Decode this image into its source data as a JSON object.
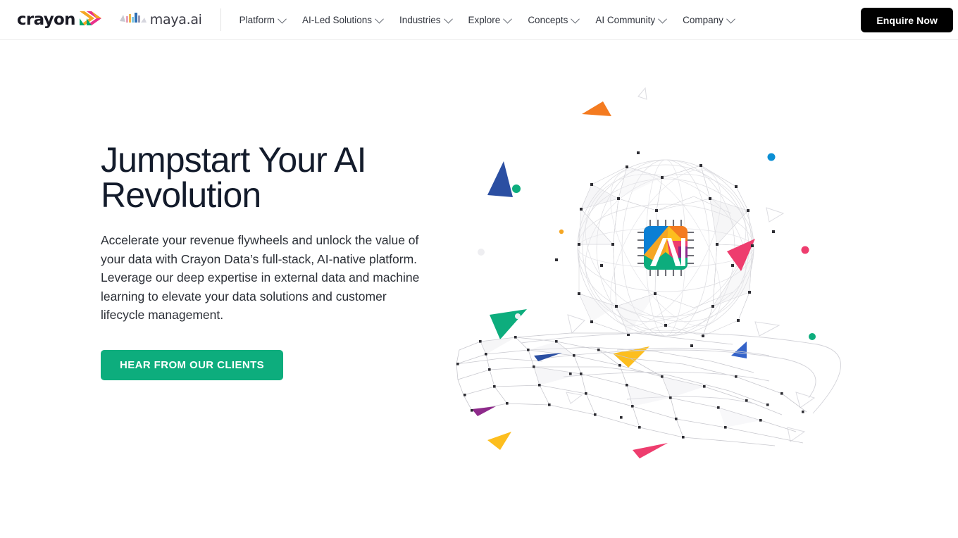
{
  "header": {
    "brand": {
      "crayon_word": "crayon",
      "crayon_icon": "crayon-chevron-logo",
      "maya_word": "maya.ai",
      "maya_icon": "maya-bars-logo"
    },
    "nav_items": [
      {
        "label": "Platform",
        "has_dropdown": true
      },
      {
        "label": "AI-Led Solutions",
        "has_dropdown": true
      },
      {
        "label": "Industries",
        "has_dropdown": true
      },
      {
        "label": "Explore",
        "has_dropdown": true
      },
      {
        "label": "Concepts",
        "has_dropdown": true
      },
      {
        "label": "AI Community",
        "has_dropdown": true
      },
      {
        "label": "Company",
        "has_dropdown": true
      }
    ],
    "cta_label": "Enquire Now",
    "cta_bg": "#000000",
    "border_color": "#ececec"
  },
  "hero": {
    "title": "Jumpstart Your AI Revolution",
    "description": "Accelerate your revenue flywheels and unlock the value of your data with Crayon Data’s full-stack, AI-native platform. Leverage our deep expertise in external data and machine learning to elevate your data solutions and customer lifecycle management.",
    "button_label": "HEAR FROM OUR CLIENTS",
    "button_bg": "#0DAD7D",
    "title_color": "#131b2b",
    "text_color": "#2b2f36",
    "illustration": {
      "name": "ai-sphere-on-wireframe-hand",
      "center_badge": "ai-chip-logo",
      "center_badge_text": "AI",
      "accent_colors": {
        "orange": "#F5A623",
        "deep_orange": "#F47B20",
        "blue": "#2B4FA2",
        "royal_blue": "#3463C9",
        "teal": "#0DAD7D",
        "pink": "#EE3D6E",
        "purple": "#8E2A8B",
        "yellow": "#FDBE1E",
        "cyan": "#0B8FD4",
        "mesh_gray": "#c9c9cd",
        "node_dark": "#2d2d33"
      }
    }
  },
  "page": {
    "background": "#ffffff"
  }
}
